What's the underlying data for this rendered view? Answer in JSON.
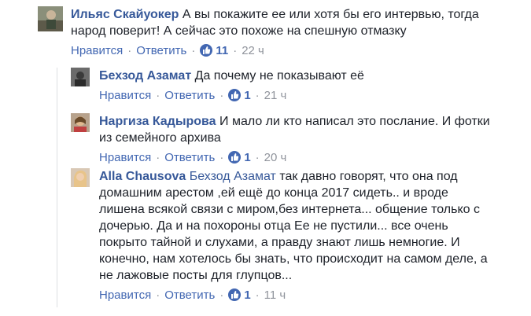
{
  "comments": [
    {
      "author": "Ильяс Скайуокер",
      "lines": [
        "А вы покажите ее или хотя бы его интервью, тогда",
        "народ поверит! А сейчас это похоже на спешную отмазку"
      ],
      "like_label": "Нравится",
      "reply_label": "Ответить",
      "likes": "11",
      "time": "22 ч"
    },
    {
      "author": "Бехзод Азамат",
      "lines": [
        "Да почему не показывают её"
      ],
      "like_label": "Нравится",
      "reply_label": "Ответить",
      "likes": "1",
      "time": "21 ч"
    },
    {
      "author": "Наргиза Кадырова",
      "lines": [
        "И мало ли кто написал это послание. И фотки",
        "из семейного архива"
      ],
      "like_label": "Нравится",
      "reply_label": "Ответить",
      "likes": "1",
      "time": "20 ч"
    },
    {
      "author": "Alla Chausova",
      "mention": "Бехзод Азамат",
      "lines": [
        "так давно говорят, что она под",
        "домашним арестом ,ей ещё до конца 2017 сидеть.. и вроде",
        "лишена всякой связи с миром,без интернета... общение только с",
        "дочерью. Да и на похороны отца Ее не пустили... все очень",
        "покрыто тайной и слухами, а правду знают лишь немногие. И",
        "конечно, нам хотелось бы знать, что происходит на самом деле, а",
        "не лажовые посты для глупцов..."
      ],
      "like_label": "Нравится",
      "reply_label": "Ответить",
      "likes": "1",
      "time": "11 ч"
    }
  ],
  "colors": {
    "link": "#365899",
    "action": "#4267b2",
    "meta": "#90949c",
    "text": "#1d2129"
  },
  "icons": {
    "like": "thumbs-up-icon"
  }
}
